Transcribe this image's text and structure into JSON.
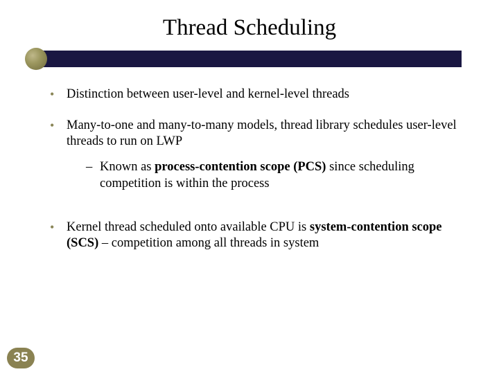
{
  "title": "Thread Scheduling",
  "bullets": {
    "b1": "Distinction between user-level and kernel-level threads",
    "b2": "Many-to-one and many-to-many models, thread library schedules user-level threads to run on LWP",
    "b2_sub": {
      "pre": "Known as ",
      "bold": "process-contention scope (PCS)",
      "post": " since scheduling competition is within the process"
    },
    "b3": {
      "pre": "Kernel thread scheduled onto available CPU is ",
      "bold": "system-contention scope (SCS)",
      "post": " – competition among all threads in system"
    }
  },
  "page_number": "35"
}
